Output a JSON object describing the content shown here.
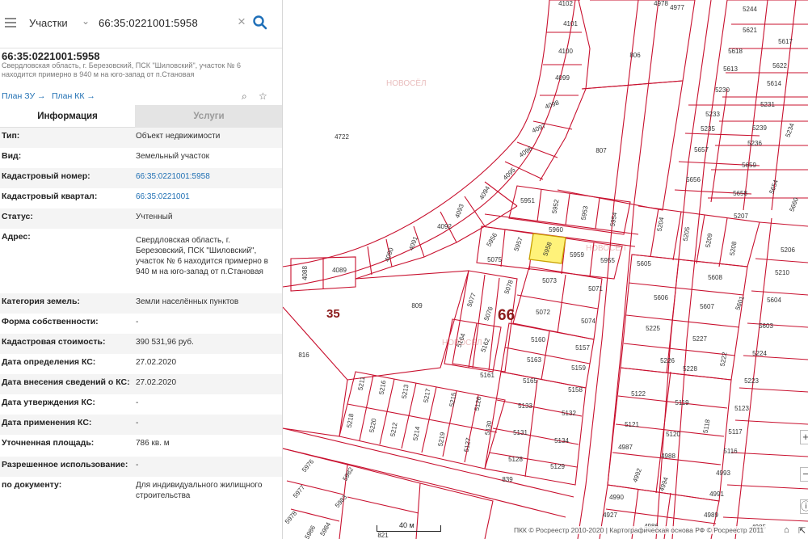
{
  "search": {
    "type_label": "Участки",
    "query": "66:35:0221001:5958"
  },
  "object": {
    "title": "66:35:0221001:5958",
    "address_short": "Свердловская область, г. Березовский, ПСК \"Шиловский\", участок № 6 находится примерно в 940 м на юго-запад от п.Становая",
    "plan_zu": "План ЗУ →",
    "plan_kk": "План КК →"
  },
  "tabs": {
    "info": "Информация",
    "services": "Услуги"
  },
  "rows": [
    {
      "k": "Тип:",
      "v": "Объект недвижимости"
    },
    {
      "k": "Вид:",
      "v": "Земельный участок"
    },
    {
      "k": "Кадастровый номер:",
      "v": "66:35:0221001:5958"
    },
    {
      "k": "Кадастровый квартал:",
      "v": "66:35:0221001"
    },
    {
      "k": "Статус:",
      "v": "Учтенный"
    },
    {
      "k": "Адрес:",
      "v": "Свердловская область, г. Березовский, ПСК \"Шиловский\", участок № 6 находится примерно в 940 м на юго-запад от п.Становая"
    },
    {
      "k": "Категория земель:",
      "v": "Земли населённых пунктов"
    },
    {
      "k": "Форма собственности:",
      "v": "-"
    },
    {
      "k": "Кадастровая стоимость:",
      "v": "390 531,96 руб."
    },
    {
      "k": "Дата определения КС:",
      "v": "27.02.2020"
    },
    {
      "k": "Дата внесения сведений о КС:",
      "v": "27.02.2020"
    },
    {
      "k": "Дата утверждения КС:",
      "v": "-"
    },
    {
      "k": "Дата применения КС:",
      "v": "-"
    },
    {
      "k": "Уточненная площадь:",
      "v": "786 кв. м"
    },
    {
      "k": "Разрешенное использование:",
      "v": "-"
    },
    {
      "k": "по документу:",
      "v": "Для индивидуального жилищного строительства"
    }
  ],
  "map": {
    "quarter_35": "35",
    "quarter_66": "66",
    "scale": "40 м",
    "attribution": "ПКК © Росреестр 2010-2020 | Картографическая основа РФ © Росреестр 2011",
    "watermark": "НОВОСЁЛ",
    "boundary_color": "#c8102e",
    "selected_fill": "#fff27a",
    "parcels": [
      "4102",
      "4978",
      "4977",
      "5244",
      "5621",
      "5617",
      "4101",
      "806",
      "5618",
      "5622",
      "4100",
      "5613",
      "5614",
      "4099",
      "5230",
      "5231",
      "4098",
      "5233",
      "5239",
      "4097",
      "5235",
      "5236",
      "5234",
      "4722",
      "4096",
      "807",
      "5657",
      "5659",
      "4095",
      "5656",
      "5658",
      "5654",
      "4094",
      "5207",
      "5660",
      "4093",
      "5951",
      "5952",
      "5953",
      "5954",
      "4092",
      "5204",
      "5205",
      "5209",
      "5208",
      "5206",
      "4091",
      "5960",
      "4090",
      "5956",
      "5957",
      "5958",
      "5959",
      "5955",
      "5605",
      "5210",
      "4088",
      "4089",
      "5075",
      "5073",
      "5071",
      "5608",
      "5078",
      "5606",
      "5601",
      "5604",
      "5077",
      "5076",
      "809",
      "5072",
      "5074",
      "5607",
      "5603",
      "5225",
      "816",
      "5164",
      "5162",
      "5160",
      "5157",
      "5227",
      "5224",
      "5163",
      "5159",
      "5226",
      "5228",
      "5222",
      "5161",
      "5165",
      "5158",
      "5211",
      "5216",
      "5213",
      "5217",
      "5215",
      "5126",
      "5223",
      "5122",
      "5119",
      "5133",
      "5132",
      "5118",
      "5218",
      "5220",
      "5212",
      "5214",
      "5219",
      "5127",
      "5130",
      "5123",
      "5121",
      "5131",
      "5134",
      "5120",
      "5117",
      "4987",
      "4988",
      "5116",
      "5128",
      "5129",
      "4992",
      "4994",
      "5976",
      "5982",
      "839",
      "4993",
      "5977",
      "4990",
      "4991",
      "5983",
      "5978",
      "5984",
      "4927",
      "4986",
      "4989",
      "5986",
      "4985",
      "821"
    ]
  }
}
